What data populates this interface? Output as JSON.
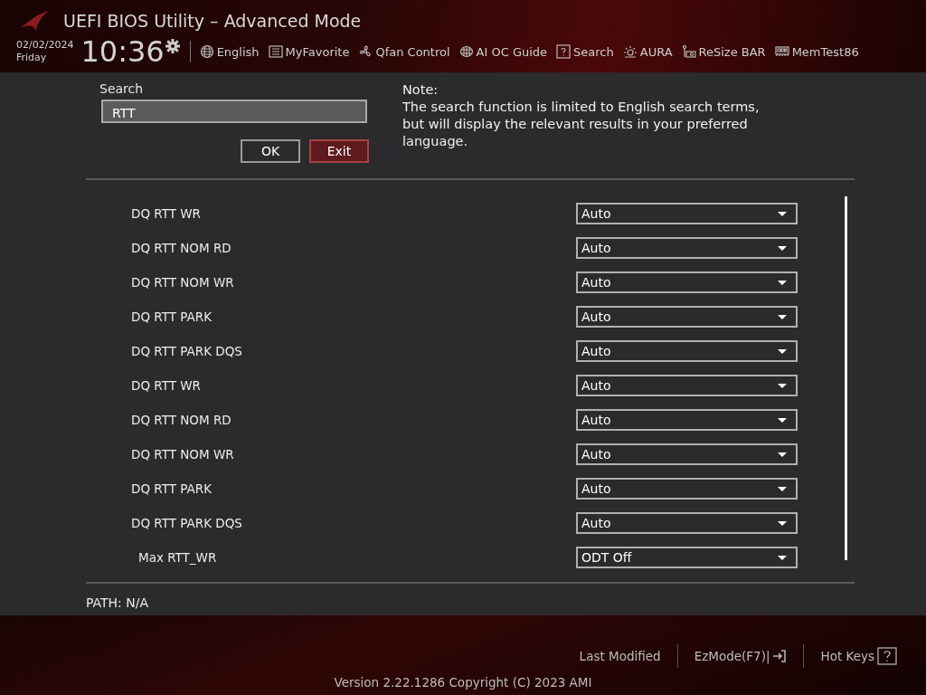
{
  "header": {
    "title": "UEFI BIOS Utility – Advanced Mode",
    "date": "02/02/2024",
    "day": "Friday",
    "time": "10:36",
    "toolbar": [
      {
        "kind": "globe",
        "label": "English"
      },
      {
        "kind": "favorite",
        "label": "MyFavorite"
      },
      {
        "kind": "fan",
        "label": "Qfan Control"
      },
      {
        "kind": "chip",
        "label": "AI OC Guide"
      },
      {
        "kind": "search",
        "label": "Search"
      },
      {
        "kind": "aura",
        "label": "AURA"
      },
      {
        "kind": "card",
        "label": "ReSize BAR"
      },
      {
        "kind": "memory",
        "label": "MemTest86"
      }
    ]
  },
  "search": {
    "label": "Search",
    "value": "RTT",
    "note_title": "Note:",
    "note": "The search function is limited to English search terms, but will display the relevant results in your preferred language.",
    "buttons": [
      {
        "label": "OK",
        "kind": "plain"
      },
      {
        "label": "Exit",
        "kind": "danger"
      }
    ]
  },
  "settings": [
    {
      "kind": "item",
      "label": "DQ RTT WR",
      "value": "Auto"
    },
    {
      "kind": "item",
      "label": "DQ RTT NOM RD",
      "value": "Auto"
    },
    {
      "kind": "item",
      "label": "DQ RTT NOM WR",
      "value": "Auto"
    },
    {
      "kind": "item",
      "label": "DQ RTT PARK",
      "value": "Auto"
    },
    {
      "kind": "item",
      "label": "DQ RTT PARK DQS",
      "value": "Auto"
    },
    {
      "kind": "item",
      "label": "DQ RTT WR",
      "value": "Auto"
    },
    {
      "kind": "item",
      "label": "DQ RTT NOM RD",
      "value": "Auto"
    },
    {
      "kind": "item",
      "label": "DQ RTT NOM WR",
      "value": "Auto"
    },
    {
      "kind": "item",
      "label": "DQ RTT PARK",
      "value": "Auto"
    },
    {
      "kind": "item",
      "label": "DQ RTT PARK DQS",
      "value": "Auto"
    },
    {
      "kind": "sub",
      "label": "Max RTT_WR",
      "value": "ODT Off"
    }
  ],
  "path": "PATH: N/A",
  "footer": {
    "links": [
      {
        "kind": "plain",
        "label": "Last Modified"
      },
      {
        "kind": "exit",
        "label": "EzMode(F7)|"
      },
      {
        "kind": "help",
        "label": "Hot Keys"
      }
    ],
    "version": "Version 2.22.1286 Copyright (C) 2023 AMI"
  }
}
